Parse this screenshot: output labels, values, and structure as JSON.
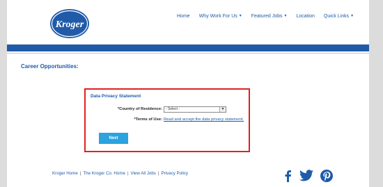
{
  "brand": {
    "logo_text": "Kroger",
    "color": "#1f5ba8"
  },
  "nav": [
    {
      "label": "Home",
      "dropdown": false
    },
    {
      "label": "Why Work For Us",
      "dropdown": true
    },
    {
      "label": "Featured Jobs",
      "dropdown": true
    },
    {
      "label": "Location",
      "dropdown": false
    },
    {
      "label": "Quick Links",
      "dropdown": true
    }
  ],
  "page": {
    "heading": "Career Opportunities:"
  },
  "form": {
    "title": "Data Privacy Statement",
    "country_label": "*Country of Residence:",
    "country_value": "- Select -",
    "terms_label": "*Terms of Use:",
    "terms_link": "Read and accept the data privacy statement.",
    "next_label": "Next"
  },
  "footer": {
    "links": [
      "Kroger Home",
      "The Kroger Co. Home",
      "View All Jobs",
      "Privacy Policy"
    ],
    "separator": "|",
    "social": [
      "facebook-icon",
      "twitter-icon",
      "pinterest-icon"
    ]
  },
  "colors": {
    "accent": "#1f5ba8",
    "button": "#2aa3de",
    "highlight_border": "#e02020"
  }
}
